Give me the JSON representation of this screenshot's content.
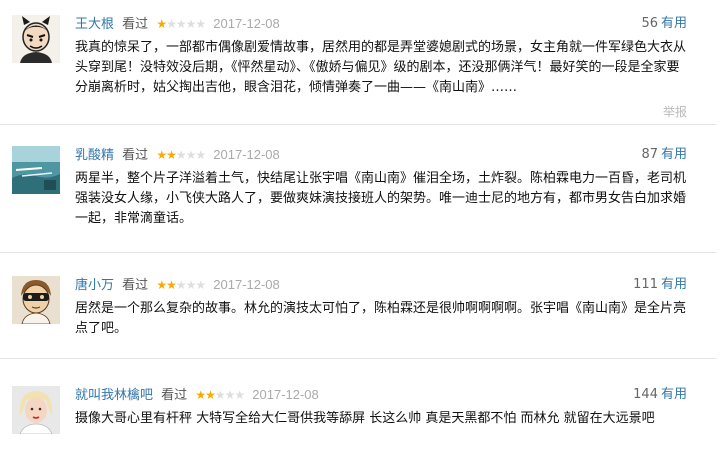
{
  "reviews": [
    {
      "username": "王大根",
      "watched": "看过",
      "rating": 1,
      "date": "2017-12-08",
      "votes": "56",
      "useful": "有用",
      "content": "我真的惊呆了，一部都市偶像剧爱情故事，居然用的都是弄堂婆媳剧式的场景，女主角就一件军绿色大衣从头穿到尾！没特效没后期，《怦然星动》、《傲娇与偏见》级的剧本，还没那俩洋气！最好笑的一段是全家要分崩离析时，姑父掏出吉他，眼含泪花，倾情弹奏了一曲——《南山南》……",
      "report": "举报",
      "avatar": "cartoon-devil-avatar"
    },
    {
      "username": "乳酸精",
      "watched": "看过",
      "rating": 2,
      "date": "2017-12-08",
      "votes": "87",
      "useful": "有用",
      "content": "两星半，整个片子洋溢着土气，快结尾让张宇唱《南山南》催泪全场，土炸裂。陈柏霖电力一百昏，老司机强装没女人缘，小飞侠大路人了，要做爽妹演技接班人的架势。唯一迪士尼的地方有，都市男女告白加求婚一起，非常滴童话。",
      "avatar": "sea-landscape-avatar"
    },
    {
      "username": "唐小万",
      "watched": "看过",
      "rating": 2,
      "date": "2017-12-08",
      "votes": "111",
      "useful": "有用",
      "content": "居然是一个那么复杂的故事。林允的演技太可怕了，陈柏霖还是很帅啊啊啊啊。张宇唱《南山南》是全片亮点了吧。",
      "avatar": "masked-man-avatar"
    },
    {
      "username": "就叫我林檎吧",
      "watched": "看过",
      "rating": 2,
      "date": "2017-12-08",
      "votes": "144",
      "useful": "有用",
      "content": "摄像大哥心里有杆秤 大特写全给大仁哥供我等舔屏 长这么帅 真是天黑都不怕 而林允 就留在大远景吧",
      "avatar": "blonde-woman-avatar"
    }
  ],
  "colors": {
    "link": "#3377aa",
    "star_on": "#f6ab00",
    "star_off": "#dedede",
    "date": "#aaaaaa"
  }
}
